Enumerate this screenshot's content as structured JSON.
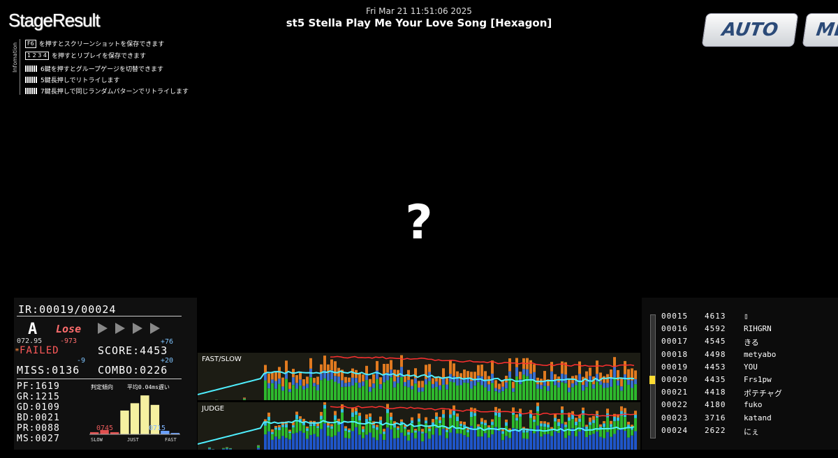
{
  "header": {
    "logo": "StageResult",
    "datetime": "Fri Mar 21 11:51:06 2025",
    "song_title": "st5 Stella Play Me Your Love Song [Hexagon]",
    "buttons": {
      "auto": "AUTO",
      "menu": "ME"
    }
  },
  "info": {
    "vertical_label": "Infomation",
    "rows": [
      {
        "key": "F6",
        "text": "を押すとスクリーンショットを保存できます"
      },
      {
        "key": "1 2 3 4",
        "text": "を押すとリプレイを保存できます"
      },
      {
        "key": "",
        "text": "6鍵を押すとグループゲージを切替できます"
      },
      {
        "key": "",
        "text": "5鍵長押しでリトライします"
      },
      {
        "key": "",
        "text": "7鍵長押しで同じランダムパターンでリトライします"
      }
    ]
  },
  "center": {
    "mark": "?"
  },
  "stats": {
    "ir": "IR:00019/00024",
    "rank": "A",
    "lose": "Lose",
    "rate": "072.95",
    "rate_diff": "-973",
    "clear_prefix": "≡",
    "clear": "FAILED",
    "score": "SCORE:4453",
    "score_diff": "+76",
    "miss": "MISS:0136",
    "miss_diff": "-9",
    "combo": "COMBO:0226",
    "combo_diff": "+20",
    "judges": [
      {
        "label": "PF:1619"
      },
      {
        "label": "GR:1215"
      },
      {
        "label": "GD:0109"
      },
      {
        "label": "BD:0021"
      },
      {
        "label": "PR:0088"
      },
      {
        "label": "MS:0027"
      }
    ],
    "histogram": {
      "title": "判定傾向",
      "avg": "平均0.04ms遅い",
      "slow_label": "SLOW",
      "just_label": "JUST",
      "fast_label": "FAST",
      "slow_count": "0745",
      "fast_count": "0715",
      "bars": [
        0.05,
        0.1,
        0.05,
        0.55,
        0.72,
        0.9,
        0.68,
        0.08,
        0.03
      ],
      "colors": {
        "slow": "#e05050",
        "center": "#f5f0a0",
        "fast": "#6aa0ff"
      }
    }
  },
  "graphs": {
    "fastslow_label": "FAST/SLOW",
    "judge_label": "JUDGE"
  },
  "ranking": {
    "rows": [
      {
        "pos": "00015",
        "score": "4613",
        "name": "▯"
      },
      {
        "pos": "00016",
        "score": "4592",
        "name": "RIHGRN"
      },
      {
        "pos": "00017",
        "score": "4545",
        "name": "きる"
      },
      {
        "pos": "00018",
        "score": "4498",
        "name": "metyabo"
      },
      {
        "pos": "00019",
        "score": "4453",
        "name": "YOU"
      },
      {
        "pos": "00020",
        "score": "4435",
        "name": "Frs1pw"
      },
      {
        "pos": "00021",
        "score": "4418",
        "name": "ポテチャグ"
      },
      {
        "pos": "00022",
        "score": "4180",
        "name": "fuko"
      },
      {
        "pos": "00023",
        "score": "3716",
        "name": "katand"
      },
      {
        "pos": "00024",
        "score": "2622",
        "name": "にぇ"
      }
    ]
  }
}
